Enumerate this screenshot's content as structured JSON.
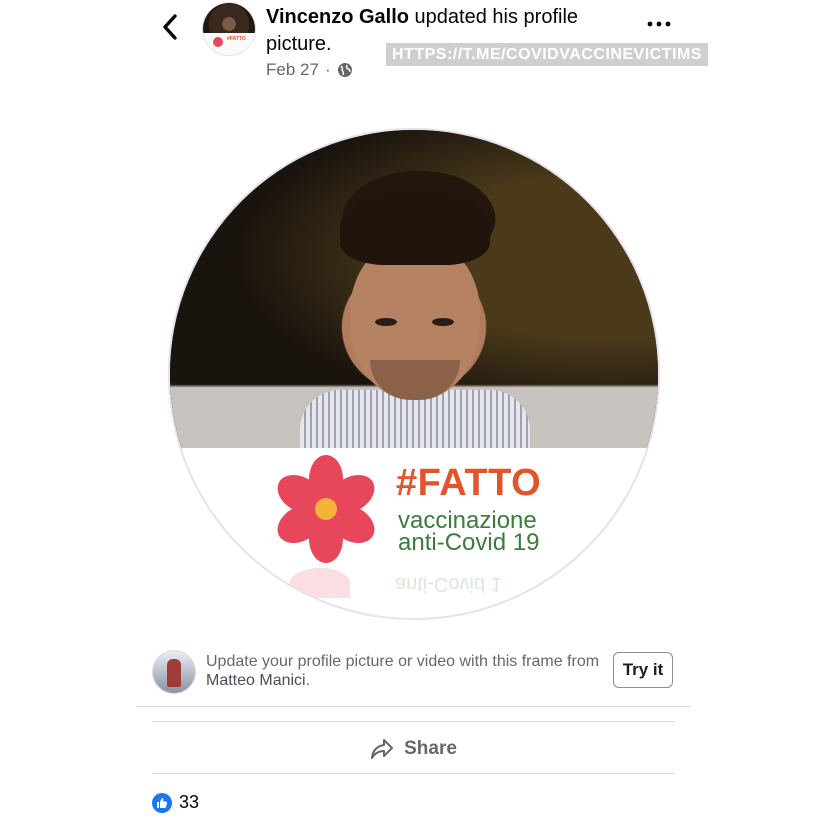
{
  "post": {
    "author": "Vincenzo Gallo",
    "action": " updated his profile picture.",
    "date": "Feb 27",
    "separator": "·",
    "audience_icon": "globe-icon",
    "more_icon": "more-dots-icon",
    "back_icon": "chevron-left-icon"
  },
  "watermark": "HTTPS://T.ME/COVIDVACCINEVICTIMS",
  "frame_overlay": {
    "hashtag": "#FATTO",
    "line1": "vaccinazione",
    "line2": "anti-Covid 19",
    "reflection": "anti-Covid 1",
    "colors": {
      "hashtag": "#e4542a",
      "text": "#3a7d3a",
      "flower": "#e8475b",
      "center": "#f4b43a"
    }
  },
  "frame_promo": {
    "text": "Update your profile picture or video with this frame from ",
    "author": "Matteo Manici",
    "suffix": ".",
    "button": "Try it"
  },
  "actions": {
    "share": "Share",
    "share_icon": "share-arrow-icon"
  },
  "reactions": {
    "icon": "like-icon",
    "count": "33",
    "color": "#1877f2"
  }
}
